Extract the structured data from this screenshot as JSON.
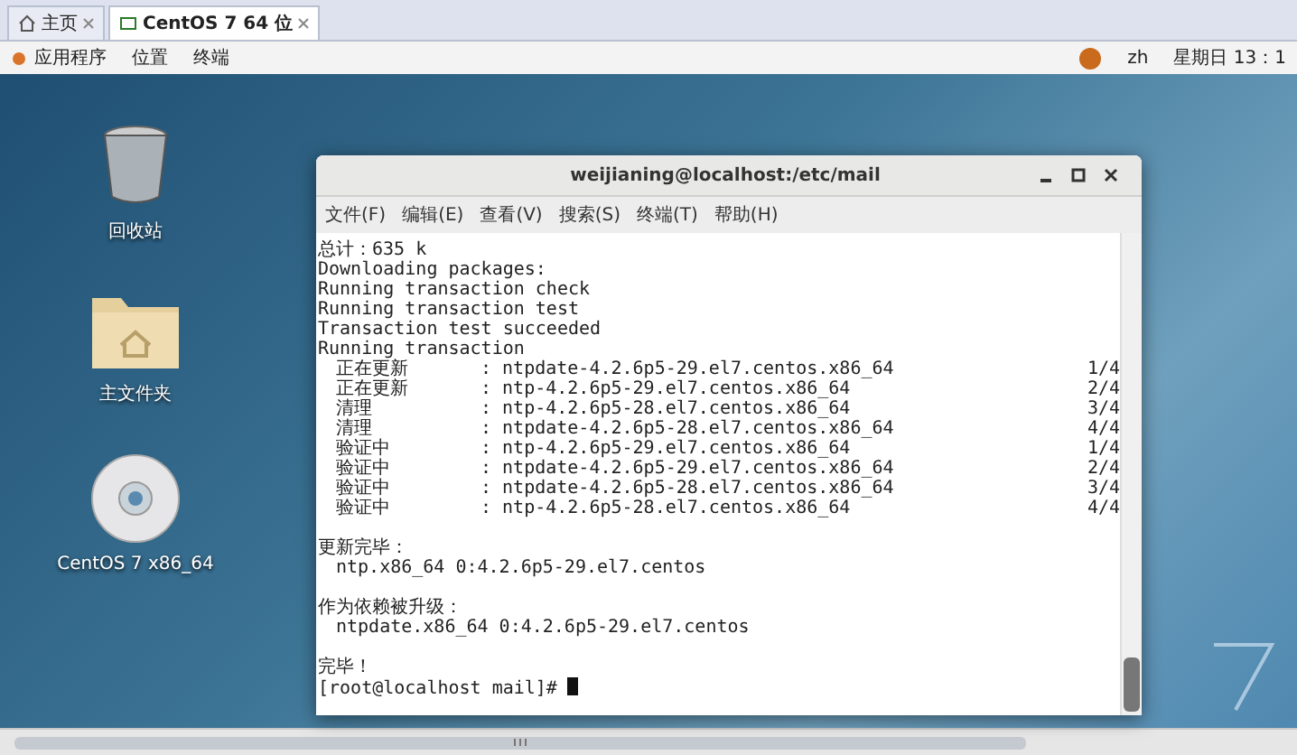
{
  "host_tabs": [
    {
      "label": "主页",
      "kind": "home",
      "selected": false
    },
    {
      "label": "CentOS 7 64 位",
      "kind": "vm",
      "selected": true
    }
  ],
  "top_bar": {
    "menus": [
      "应用程序",
      "位置",
      "终端"
    ],
    "language": "zh",
    "clock": "星期日 13：1"
  },
  "desktop_icons": [
    {
      "kind": "trash",
      "label": "回收站"
    },
    {
      "kind": "folder",
      "label": "主文件夹"
    },
    {
      "kind": "disc",
      "label": "CentOS 7 x86_64"
    }
  ],
  "terminal": {
    "title": "weijianing@localhost:/etc/mail",
    "menu": [
      "文件(F)",
      "编辑(E)",
      "查看(V)",
      "搜索(S)",
      "终端(T)",
      "帮助(H)"
    ],
    "lines": [
      {
        "kind": "text",
        "text": "总计：635 k"
      },
      {
        "kind": "text",
        "text": "Downloading packages:"
      },
      {
        "kind": "text",
        "text": "Running transaction check"
      },
      {
        "kind": "text",
        "text": "Running transaction test"
      },
      {
        "kind": "text",
        "text": "Transaction test succeeded"
      },
      {
        "kind": "text",
        "text": "Running transaction"
      },
      {
        "kind": "row",
        "action": "正在更新",
        "package": ": ntpdate-4.2.6p5-29.el7.centos.x86_64",
        "count": "1/4"
      },
      {
        "kind": "row",
        "action": "正在更新",
        "package": ": ntp-4.2.6p5-29.el7.centos.x86_64",
        "count": "2/4"
      },
      {
        "kind": "row",
        "action": "清理",
        "package": ": ntp-4.2.6p5-28.el7.centos.x86_64",
        "count": "3/4"
      },
      {
        "kind": "row",
        "action": "清理",
        "package": ": ntpdate-4.2.6p5-28.el7.centos.x86_64",
        "count": "4/4"
      },
      {
        "kind": "row",
        "action": "验证中",
        "package": ": ntp-4.2.6p5-29.el7.centos.x86_64",
        "count": "1/4"
      },
      {
        "kind": "row",
        "action": "验证中",
        "package": ": ntpdate-4.2.6p5-29.el7.centos.x86_64",
        "count": "2/4"
      },
      {
        "kind": "row",
        "action": "验证中",
        "package": ": ntpdate-4.2.6p5-28.el7.centos.x86_64",
        "count": "3/4"
      },
      {
        "kind": "row",
        "action": "验证中",
        "package": ": ntp-4.2.6p5-28.el7.centos.x86_64",
        "count": "4/4"
      },
      {
        "kind": "blank"
      },
      {
        "kind": "text",
        "text": "更新完毕："
      },
      {
        "kind": "indented",
        "text": "ntp.x86_64 0:4.2.6p5-29.el7.centos"
      },
      {
        "kind": "blank"
      },
      {
        "kind": "text",
        "text": "作为依赖被升级："
      },
      {
        "kind": "indented",
        "text": "ntpdate.x86_64 0:4.2.6p5-29.el7.centos"
      },
      {
        "kind": "blank"
      },
      {
        "kind": "text",
        "text": "完毕！"
      },
      {
        "kind": "prompt",
        "text": "[root@localhost mail]#"
      }
    ]
  }
}
